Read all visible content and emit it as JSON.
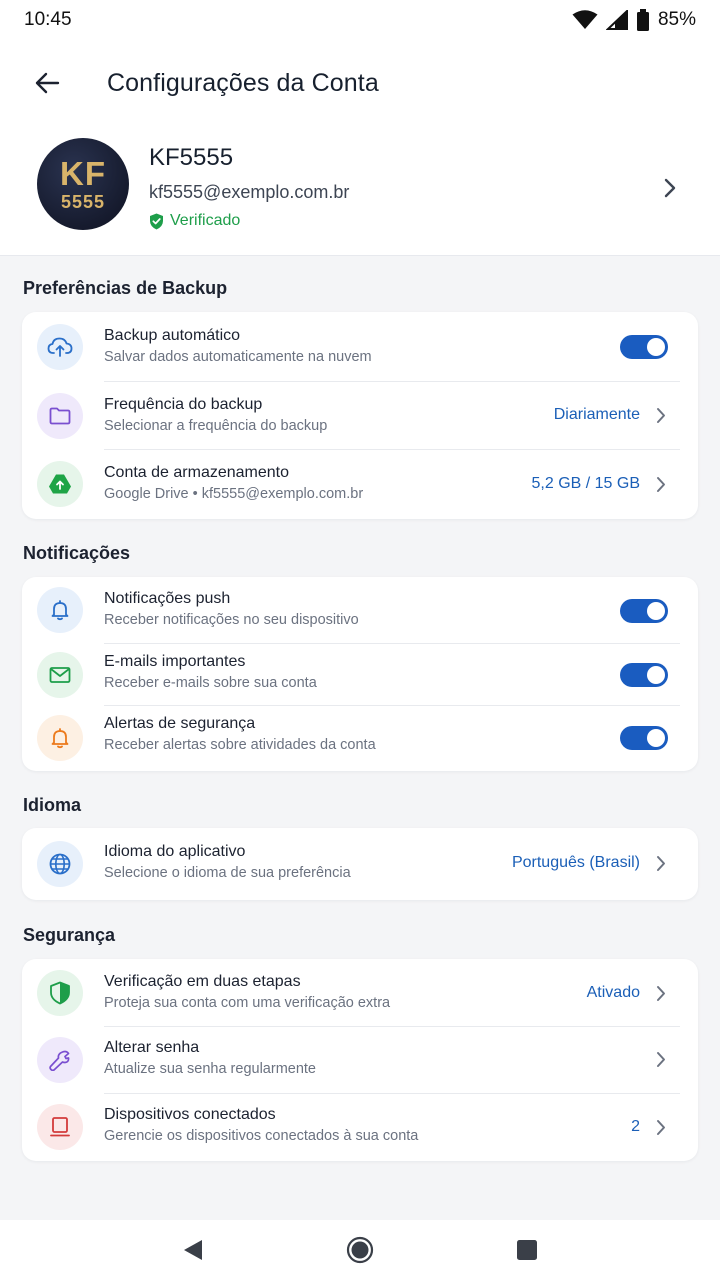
{
  "status_bar": {
    "time": "10:45",
    "battery": "85%"
  },
  "app_bar": {
    "title": "Configurações da Conta"
  },
  "profile": {
    "avatar_line1": "KF",
    "avatar_line2": "5555",
    "name": "KF5555",
    "email": "kf5555@exemplo.com.br",
    "verified_label": "Verificado"
  },
  "sections": {
    "backup": {
      "title": "Preferências de Backup",
      "auto_backup": {
        "title": "Backup automático",
        "subtitle": "Salvar dados automaticamente na nuvem",
        "enabled": true
      },
      "frequency": {
        "title": "Frequência do backup",
        "subtitle": "Selecionar a frequência do backup",
        "value": "Diariamente"
      },
      "storage": {
        "title": "Conta de armazenamento",
        "subtitle": "Google Drive • kf5555@exemplo.com.br",
        "value": "5,2 GB / 15 GB"
      }
    },
    "notifications": {
      "title": "Notificações",
      "push": {
        "title": "Notificações push",
        "subtitle": "Receber notificações no seu dispositivo",
        "enabled": true
      },
      "emails": {
        "title": "E-mails importantes",
        "subtitle": "Receber e-mails sobre sua conta",
        "enabled": true
      },
      "security_alerts": {
        "title": "Alertas de segurança",
        "subtitle": "Receber alertas sobre atividades da conta",
        "enabled": true
      }
    },
    "language": {
      "title": "Idioma",
      "app_language": {
        "title": "Idioma do aplicativo",
        "subtitle": "Selecione o idioma de sua preferência",
        "value": "Português (Brasil)"
      }
    },
    "security": {
      "title": "Segurança",
      "two_step": {
        "title": "Verificação em duas etapas",
        "subtitle": "Proteja sua conta com uma verificação extra",
        "value": "Ativado"
      },
      "change_password": {
        "title": "Alterar senha",
        "subtitle": "Atualize sua senha regularmente"
      },
      "devices": {
        "title": "Dispositivos conectados",
        "subtitle": "Gerencie os dispositivos conectados à sua conta",
        "value": "2"
      }
    }
  },
  "colors": {
    "accent": "#1a5cc0",
    "value_text": "#1b5fb7",
    "verified": "#1e9e4a",
    "avatar_text": "#d9b46a"
  },
  "icons": {
    "back": "arrow-left-icon",
    "chevron": "chevron-right-icon",
    "cloud_upload": "cloud-upload-icon",
    "folder": "folder-icon",
    "drive": "google-drive-icon",
    "bell": "bell-icon",
    "mail": "mail-icon",
    "alert_bell": "alert-bell-icon",
    "globe": "globe-icon",
    "shield": "shield-icon",
    "wrench": "wrench-icon",
    "device": "device-icon"
  }
}
